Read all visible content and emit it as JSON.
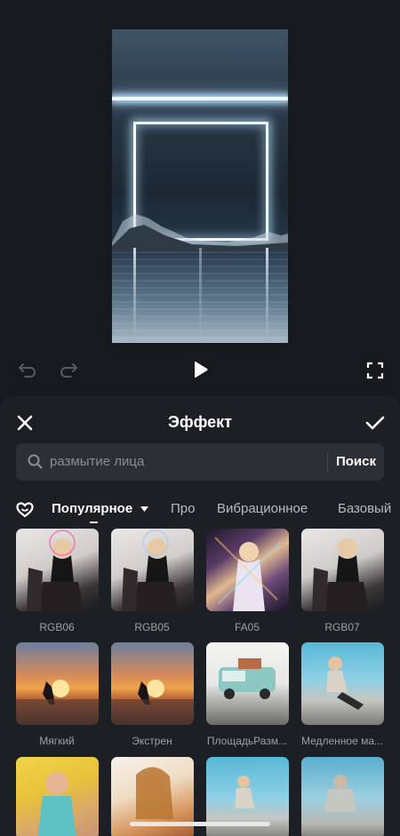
{
  "sheet": {
    "title": "Эффект",
    "close_icon": "close-icon",
    "confirm_icon": "checkmark-icon"
  },
  "search": {
    "placeholder": "размытие лица",
    "button_label": "Поиск",
    "icon": "search-icon"
  },
  "tabs": {
    "favorites_icon": "heart-icon",
    "items": [
      {
        "label": "Популярное",
        "active": true,
        "dropdown": true
      },
      {
        "label": "Про"
      },
      {
        "label": "Вибрационное"
      },
      {
        "label": "Базовый"
      }
    ]
  },
  "effects": [
    {
      "label": "RGB06"
    },
    {
      "label": "RGB05"
    },
    {
      "label": "FA05"
    },
    {
      "label": "RGB07"
    },
    {
      "label": "Мягкий"
    },
    {
      "label": "Экстрен"
    },
    {
      "label": "ПлощадьРазм..."
    },
    {
      "label": "Медленное ма..."
    },
    {
      "label": ""
    },
    {
      "label": ""
    },
    {
      "label": ""
    },
    {
      "label": ""
    }
  ],
  "player": {
    "undo_icon": "undo-icon",
    "redo_icon": "redo-icon",
    "play_icon": "play-icon",
    "fullscreen_icon": "fullscreen-icon"
  },
  "colors": {
    "background": "#161a1e",
    "sheet": "#1c2025",
    "search_field": "#2c3036"
  }
}
